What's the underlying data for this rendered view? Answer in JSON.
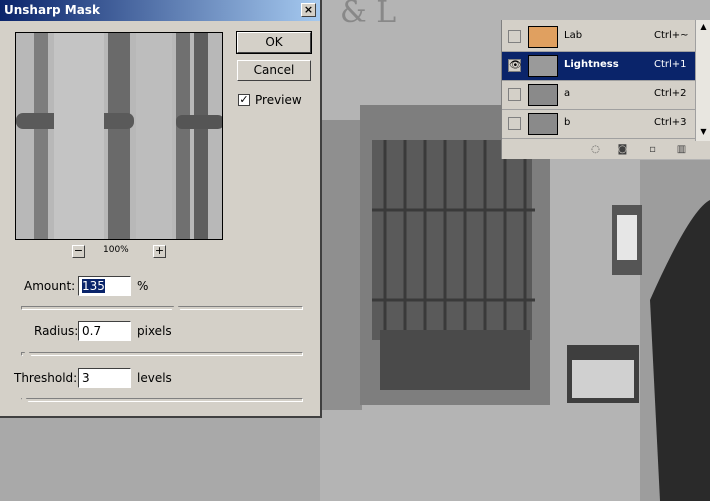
{
  "dialog": {
    "title": "Unsharp Mask",
    "close_label": "×",
    "zoom_out_label": "−",
    "zoom_in_label": "+",
    "zoom_level": "100%",
    "ok_label": "OK",
    "cancel_label": "Cancel",
    "preview_label": "Preview",
    "preview_checked": true,
    "preview_check_mark": "✓",
    "amount": {
      "label": "Amount:",
      "value": "135",
      "unit": "%",
      "slider_fraction": 0.55
    },
    "radius": {
      "label": "Radius:",
      "value": "0.7",
      "unit": "pixels",
      "slider_fraction": 0.02
    },
    "threshold": {
      "label": "Threshold:",
      "value": "3",
      "unit": "levels",
      "slider_fraction": 0.01
    }
  },
  "channels": {
    "rows": [
      {
        "name": "Lab",
        "shortcut": "Ctrl+~",
        "visible": false,
        "selected": false
      },
      {
        "name": "Lightness",
        "shortcut": "Ctrl+1",
        "visible": true,
        "selected": true
      },
      {
        "name": "a",
        "shortcut": "Ctrl+2",
        "visible": false,
        "selected": false
      },
      {
        "name": "b",
        "shortcut": "Ctrl+3",
        "visible": false,
        "selected": false
      }
    ],
    "eye_glyph": "👁",
    "scroll_up": "▲",
    "scroll_down": "▼"
  },
  "colors": {
    "titlebar": "#0a246a",
    "selected_row": "#0a246a",
    "dialog_bg": "#d4d0c8"
  }
}
